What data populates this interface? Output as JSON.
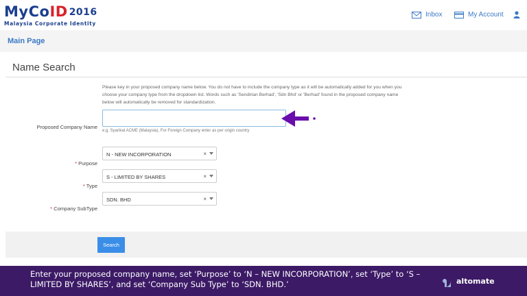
{
  "header": {
    "logo": {
      "part1": "MyCo",
      "part2": "ID",
      "year": "2016",
      "tagline": "Malaysia Corporate Identity"
    },
    "nav": {
      "inbox_label": "Inbox",
      "account_label": "My Account"
    },
    "icons": {
      "inbox": "envelope-icon",
      "account": "card-icon",
      "user": "user-icon"
    }
  },
  "main": {
    "title": "Main Page"
  },
  "form": {
    "title": "Name Search",
    "instructions": "Please key in your proposed company name below. You do not have to include the company type as it will be automatically added for you when you choose your company type from the dropdown list. Words such as 'Sendirian Berhad', 'Sdn Bhd' or 'Berhad' found in the proposed company name below will automatically be removed for standardization.",
    "company_name": {
      "label": "Proposed Company Name",
      "value": "",
      "hint": "e.g. Syarikat ACME (Malaysia), For Foreign Company enter as per origin country"
    },
    "purpose": {
      "label": "Purpose",
      "required": "*",
      "value": "N - NEW INCORPORATION"
    },
    "type": {
      "label": "Type",
      "required": "*",
      "value": "S - LIMITED BY SHARES"
    },
    "subtype": {
      "label": "Company SubType",
      "required": "*",
      "value": "SDN. BHD"
    },
    "clear_glyph": "×",
    "search_label": "Search"
  },
  "caption": {
    "text": "Enter your proposed company name, set ‘Purpose’ to ‘N – NEW INCORPORATION’, set ‘Type’ to ‘S – LIMITED BY SHARES’, and set ‘Company Sub Type’ to ‘SDN. BHD.’",
    "brand": "altomate"
  },
  "colors": {
    "accent": "#3a79c4",
    "button": "#3a8ee8",
    "caption_bg": "#3c1a66",
    "arrow": "#6a0dad",
    "logo_blue": "#1b3f8f",
    "logo_red": "#d8232a"
  }
}
